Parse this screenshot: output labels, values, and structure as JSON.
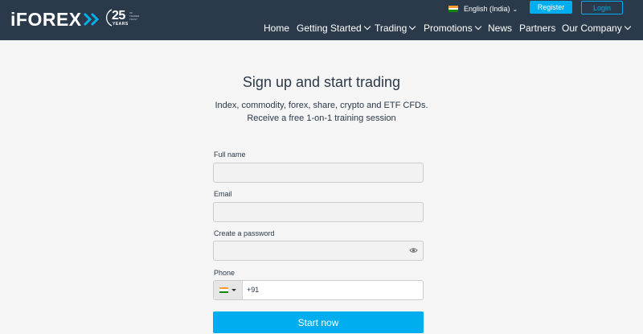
{
  "brand": {
    "logo_text": "iFOREX",
    "years_number": "25",
    "years_word": "YEARS",
    "years_tagline": "OF TRADER TRUST"
  },
  "header": {
    "language_label": "English (India)",
    "language_icon": "india-flag-icon",
    "register_label": "Register",
    "login_label": "Login"
  },
  "nav": {
    "items": [
      {
        "label": "Home",
        "has_dropdown": false
      },
      {
        "label": "Getting Started",
        "has_dropdown": true
      },
      {
        "label": "Trading",
        "has_dropdown": true
      },
      {
        "label": "Promotions",
        "has_dropdown": true
      },
      {
        "label": "News",
        "has_dropdown": false
      },
      {
        "label": "Partners",
        "has_dropdown": false
      },
      {
        "label": "Our Company",
        "has_dropdown": true
      }
    ]
  },
  "main": {
    "title": "Sign up and start trading",
    "subtitle_line1": "Index, commodity, forex, share, crypto and ETF CFDs.",
    "subtitle_line2": "Receive a free 1-on-1 training session"
  },
  "form": {
    "full_name_label": "Full name",
    "full_name_value": "",
    "email_label": "Email",
    "email_value": "",
    "password_label": "Create a password",
    "password_value": "",
    "phone_label": "Phone",
    "phone_code": "+91",
    "phone_value": "",
    "submit_label": "Start now"
  },
  "colors": {
    "header_bg": "#2b3a4a",
    "accent": "#00aeef",
    "page_bg": "#f5f5f5"
  }
}
